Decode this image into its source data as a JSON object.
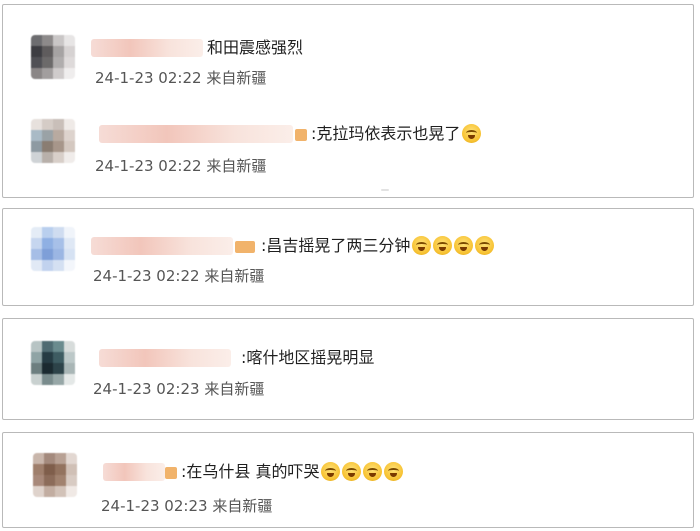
{
  "colors": {
    "border": "#b9b9b9",
    "text": "#1f1f1f",
    "meta": "#555555",
    "name_blur": "#f2c6bb"
  },
  "cards": [
    {
      "comments": [
        {
          "text": "和田震感强烈",
          "date": "24-1-23 02:22",
          "source": "来自新疆",
          "emoji_count": 0
        },
        {
          "text": ":克拉玛依表示也晃了",
          "date": "24-1-23 02:22",
          "source": "来自新疆",
          "emoji_count": 1
        }
      ]
    },
    {
      "comments": [
        {
          "text": ":昌吉摇晃了两三分钟",
          "date": "24-1-23 02:22",
          "source": "来自新疆",
          "emoji_count": 4
        }
      ]
    },
    {
      "comments": [
        {
          "text": ":喀什地区摇晃明显",
          "date": "24-1-23 02:23",
          "source": "来自新疆",
          "emoji_count": 0
        }
      ]
    },
    {
      "comments": [
        {
          "text": ":在乌什县 真的吓哭",
          "date": "24-1-23 02:23",
          "source": "来自新疆",
          "emoji_count": 4
        }
      ]
    }
  ]
}
